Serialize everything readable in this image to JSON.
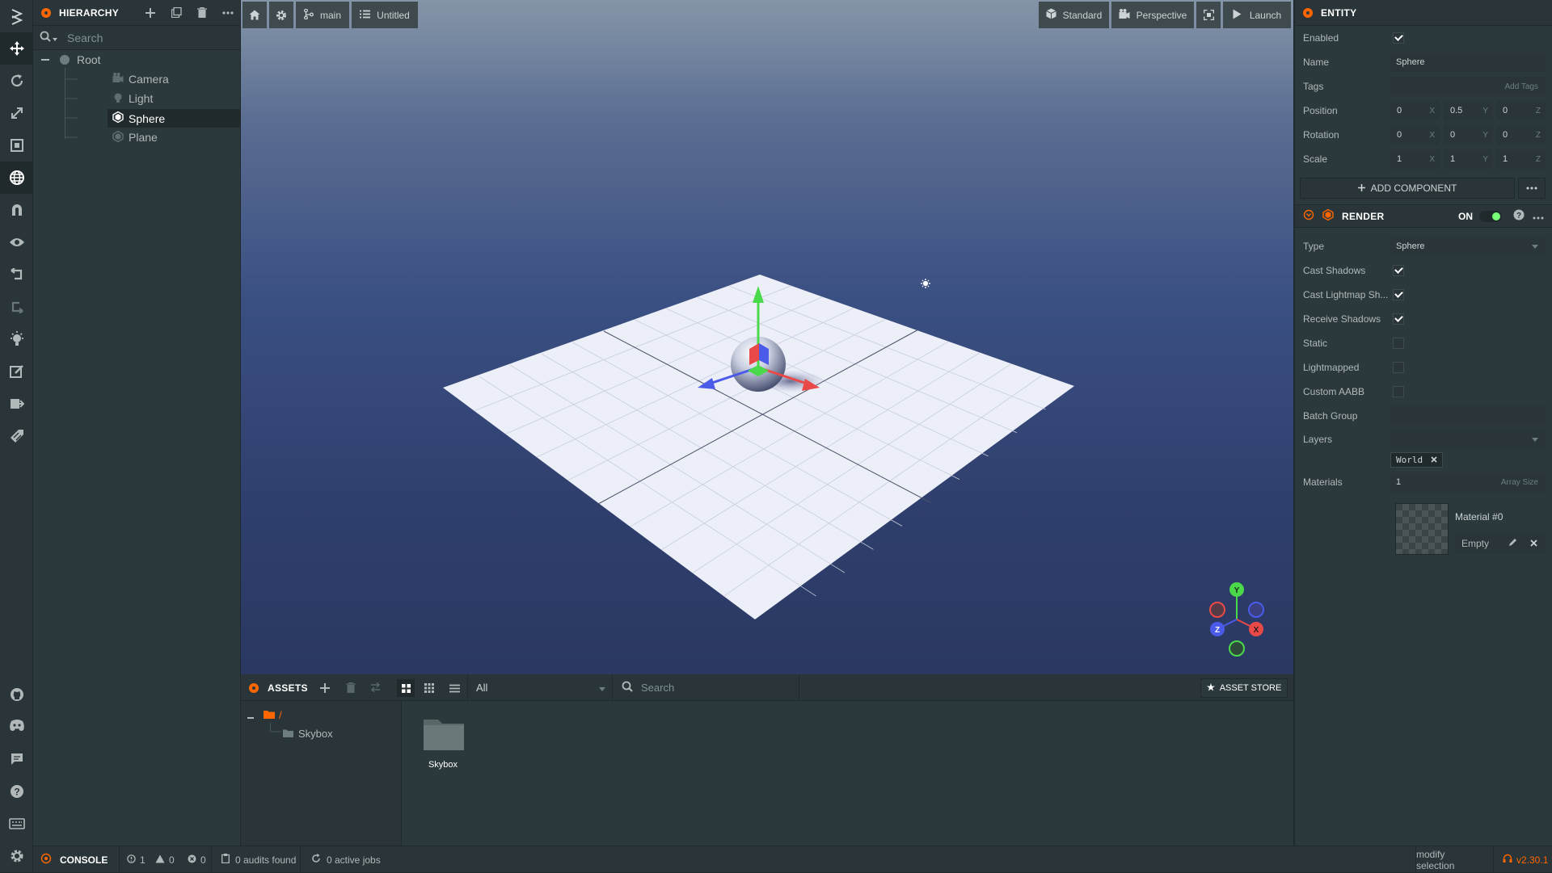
{
  "hierarchy": {
    "title": "HIERARCHY",
    "search_placeholder": "Search",
    "items": [
      {
        "label": "Root"
      },
      {
        "label": "Camera"
      },
      {
        "label": "Light"
      },
      {
        "label": "Sphere"
      },
      {
        "label": "Plane"
      }
    ]
  },
  "viewport": {
    "home_label": "",
    "branch": "main",
    "scene": "Untitled",
    "render_mode": "Standard",
    "camera": "Perspective",
    "launch": "Launch",
    "gizmo_axes": {
      "x": "X",
      "y": "Y",
      "z": "Z"
    },
    "colors": {
      "x": "#e94a48",
      "y": "#4ad94a",
      "z": "#4a5ae9"
    }
  },
  "inspector": {
    "entity_title": "ENTITY",
    "enabled_label": "Enabled",
    "enabled": true,
    "name_label": "Name",
    "name_value": "Sphere",
    "tags_label": "Tags",
    "add_tags": "Add Tags",
    "position_label": "Position",
    "position": [
      "0",
      "0.5",
      "0"
    ],
    "rotation_label": "Rotation",
    "rotation": [
      "0",
      "0",
      "0"
    ],
    "scale_label": "Scale",
    "scale": [
      "1",
      "1",
      "1"
    ],
    "axis_x": "X",
    "axis_y": "Y",
    "axis_z": "Z",
    "add_component": "ADD COMPONENT",
    "render": {
      "title": "RENDER",
      "on_label": "ON",
      "type_label": "Type",
      "type_value": "Sphere",
      "cast_shadows_label": "Cast Shadows",
      "cast_lightmap_label": "Cast Lightmap Sh...",
      "receive_shadows_label": "Receive Shadows",
      "static_label": "Static",
      "lightmapped_label": "Lightmapped",
      "custom_aabb_label": "Custom AABB",
      "batch_group_label": "Batch Group",
      "layers_label": "Layers",
      "layer_tag": "World",
      "materials_label": "Materials",
      "materials_count": "1",
      "array_size": "Array Size",
      "material_name": "Material #0",
      "material_value": "Empty"
    }
  },
  "assets": {
    "title": "ASSETS",
    "filter": "All",
    "search_placeholder": "Search",
    "asset_store": "ASSET STORE",
    "root_label": "/",
    "tree_items": [
      {
        "label": "Skybox"
      }
    ],
    "grid_items": [
      {
        "label": "Skybox"
      }
    ]
  },
  "statusbar": {
    "console": "CONSOLE",
    "info_count": "1",
    "warn_count": "0",
    "error_count": "0",
    "audits": "0 audits found",
    "jobs": "0 active jobs",
    "hint": "modify selection",
    "version": "v2.30.1"
  },
  "accent": "#ff6600"
}
